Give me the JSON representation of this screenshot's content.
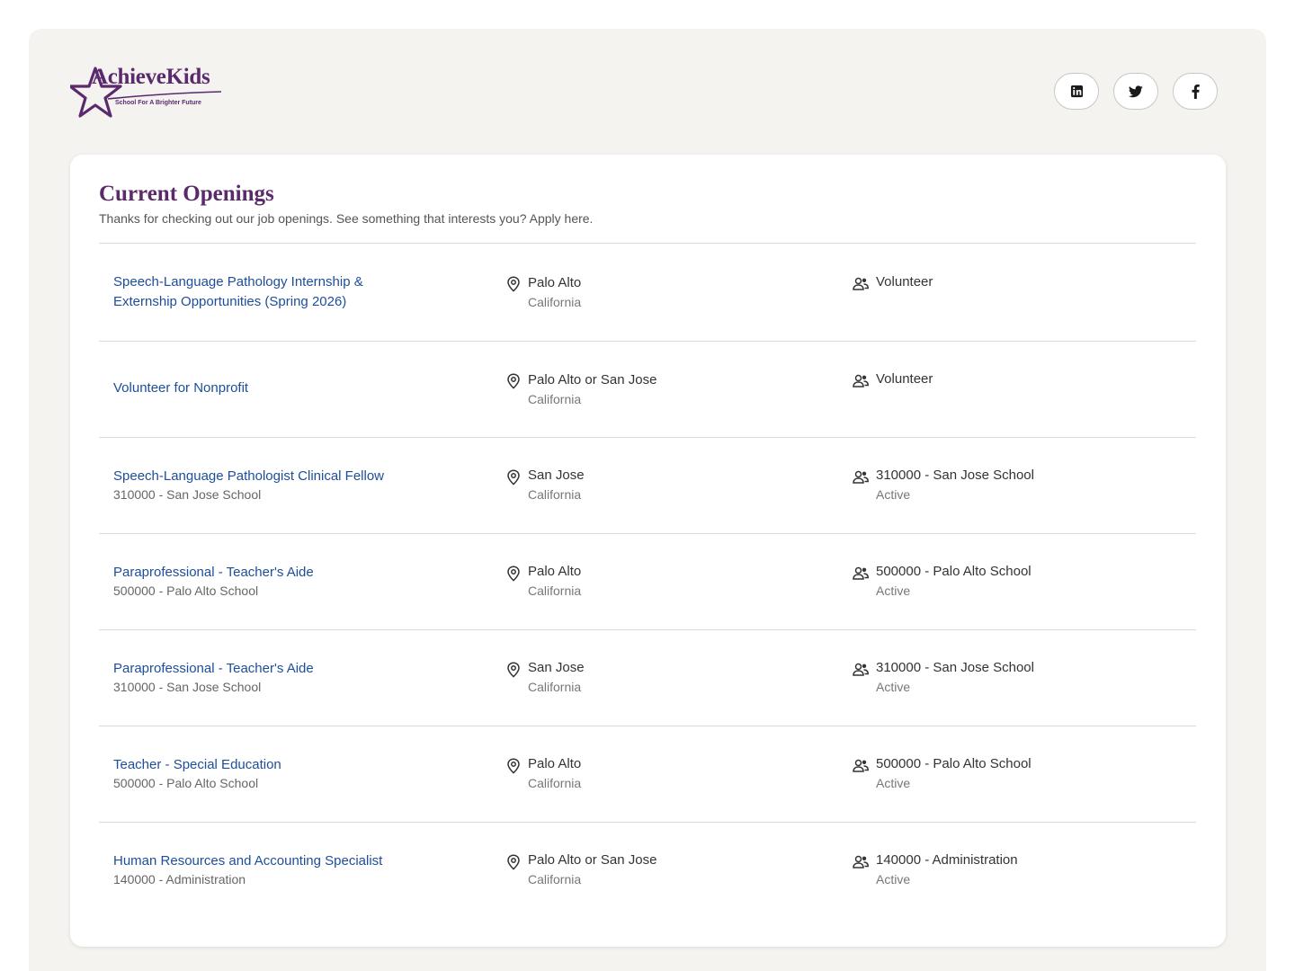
{
  "brand": {
    "name": "AchieveKids",
    "tagline": "School For A Brighter Future",
    "color": "#5b2a6e"
  },
  "social": [
    {
      "name": "linkedin",
      "icon": "linkedin-icon"
    },
    {
      "name": "twitter",
      "icon": "twitter-icon"
    },
    {
      "name": "facebook",
      "icon": "facebook-icon"
    }
  ],
  "openings": {
    "title": "Current Openings",
    "subtitle": "Thanks for checking out our job openings. See something that interests you? Apply here.",
    "jobs": [
      {
        "title_line1": "Speech-Language Pathology Internship &",
        "title_line2": "Externship Opportunities (Spring 2026)",
        "subtitle": "",
        "location": "Palo Alto",
        "region": "California",
        "department": "Volunteer",
        "status": ""
      },
      {
        "title_line1": "Volunteer for Nonprofit",
        "title_line2": "",
        "subtitle": "",
        "location": "Palo Alto or San Jose",
        "region": "California",
        "department": "Volunteer",
        "status": ""
      },
      {
        "title_line1": "Speech-Language Pathologist Clinical Fellow",
        "title_line2": "",
        "subtitle": "310000 - San Jose School",
        "location": "San Jose",
        "region": "California",
        "department": "310000 - San Jose School",
        "status": "Active"
      },
      {
        "title_line1": "Paraprofessional - Teacher's Aide",
        "title_line2": "",
        "subtitle": "500000 - Palo Alto School",
        "location": "Palo Alto",
        "region": "California",
        "department": "500000 - Palo Alto School",
        "status": "Active"
      },
      {
        "title_line1": "Paraprofessional - Teacher's Aide",
        "title_line2": "",
        "subtitle": "310000 - San Jose School",
        "location": "San Jose",
        "region": "California",
        "department": "310000 - San Jose School",
        "status": "Active"
      },
      {
        "title_line1": "Teacher - Special Education",
        "title_line2": "",
        "subtitle": "500000 - Palo Alto School",
        "location": "Palo Alto",
        "region": "California",
        "department": "500000 - Palo Alto School",
        "status": "Active"
      },
      {
        "title_line1": "Human Resources and Accounting Specialist",
        "title_line2": "",
        "subtitle": "140000 - Administration",
        "location": "Palo Alto or San Jose",
        "region": "California",
        "department": "140000 - Administration",
        "status": "Active"
      }
    ]
  },
  "colors": {
    "link": "#1d4e9a",
    "heading": "#5a2a6a",
    "page_bg": "#f4f3f0"
  },
  "icons": {
    "location": "map-pin-icon",
    "department": "people-icon"
  }
}
